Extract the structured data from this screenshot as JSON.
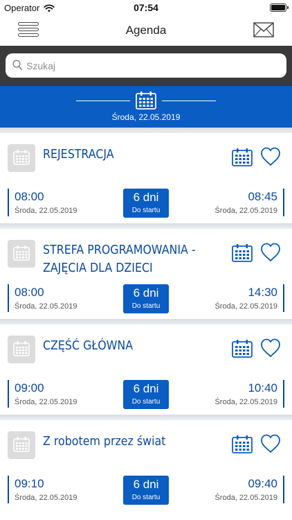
{
  "status_bar": {
    "carrier": "Operator",
    "time": "07:54",
    "battery_level": 1.0
  },
  "nav": {
    "title": "Agenda",
    "menu_icon": "hamburger-icon",
    "mail_icon": "envelope-icon"
  },
  "search": {
    "placeholder": "Szukaj",
    "value": ""
  },
  "date_header": {
    "date": "Środa, 22.05.2019"
  },
  "colors": {
    "brand_blue": "#0a5dc2",
    "title_blue": "#0a4aa5",
    "search_bg": "#3a3a3c"
  },
  "events": [
    {
      "title": "REJESTRACJA",
      "start": "08:00",
      "end": "08:45",
      "start_date": "Środa, 22.05.2019",
      "end_date": "Środa, 22.05.2019",
      "badge_value": "6 dni",
      "badge_label": "Do startu"
    },
    {
      "title": "STREFA PROGRAMOWANIA - ZAJĘCIA DLA DZIECI",
      "start": "08:00",
      "end": "14:30",
      "start_date": "Środa, 22.05.2019",
      "end_date": "Środa, 22.05.2019",
      "badge_value": "6 dni",
      "badge_label": "Do startu"
    },
    {
      "title": "CZĘŚĆ GŁÓWNA",
      "start": "09:00",
      "end": "10:40",
      "start_date": "Środa, 22.05.2019",
      "end_date": "Środa, 22.05.2019",
      "badge_value": "6 dni",
      "badge_label": "Do startu"
    },
    {
      "title": "Z robotem przez świat",
      "start": "09:10",
      "end": "09:40",
      "start_date": "Środa, 22.05.2019",
      "end_date": "Środa, 22.05.2019",
      "badge_value": "6 dni",
      "badge_label": "Do startu"
    }
  ]
}
